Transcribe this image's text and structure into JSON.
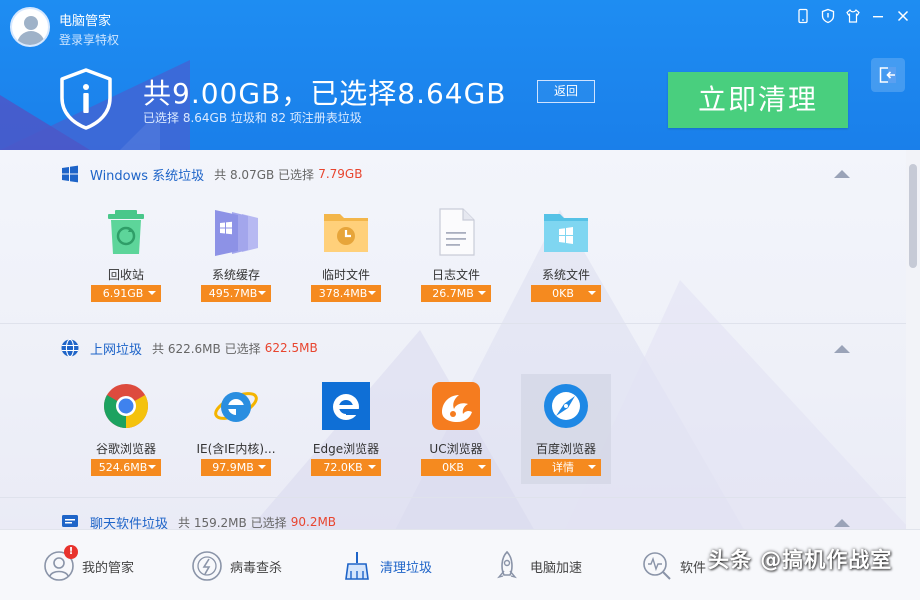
{
  "header": {
    "app_title": "电脑管家",
    "vip_link": "登录享特权",
    "window_buttons": [
      "phone-icon",
      "shield-badge-icon",
      "skin-icon",
      "minimize-icon",
      "close-icon"
    ],
    "summary_title": "共9.00GB，已选择8.64GB",
    "summary_sub": "已选择 8.64GB 垃圾和 82 项注册表垃圾",
    "back_label": "返回",
    "clean_label": "立即清理"
  },
  "sections": [
    {
      "title": "Windows 系统垃圾",
      "total": "共 8.07GB 已选择",
      "selected": "7.79GB",
      "items": [
        {
          "label": "回收站",
          "size": "6.91GB",
          "icon": "recycle-bin-icon"
        },
        {
          "label": "系统缓存",
          "size": "495.7MB",
          "icon": "system-cache-icon"
        },
        {
          "label": "临时文件",
          "size": "378.4MB",
          "icon": "temp-folder-icon"
        },
        {
          "label": "日志文件",
          "size": "26.7MB",
          "icon": "log-file-icon"
        },
        {
          "label": "系统文件",
          "size": "0KB",
          "icon": "system-folder-icon"
        }
      ]
    },
    {
      "title": "上网垃圾",
      "total": "共 622.6MB 已选择",
      "selected": "622.5MB",
      "items": [
        {
          "label": "谷歌浏览器",
          "size": "524.6MB",
          "icon": "chrome-icon"
        },
        {
          "label": "IE(含IE内核)...",
          "size": "97.9MB",
          "icon": "ie-icon"
        },
        {
          "label": "Edge浏览器",
          "size": "72.0KB",
          "icon": "edge-icon"
        },
        {
          "label": "UC浏览器",
          "size": "0KB",
          "icon": "uc-icon"
        },
        {
          "label": "百度浏览器",
          "size": "详情",
          "icon": "baidu-browser-icon"
        }
      ]
    },
    {
      "title": "聊天软件垃圾",
      "total": "共 159.2MB 已选择",
      "selected": "90.2MB",
      "items": []
    }
  ],
  "bottom_nav": [
    {
      "label": "我的管家",
      "badge": "!"
    },
    {
      "label": "病毒查杀"
    },
    {
      "label": "清理垃圾"
    },
    {
      "label": "电脑加速"
    },
    {
      "label": "软件"
    }
  ],
  "watermark": "头条 @搞机作战室",
  "colors": {
    "header_blue": "#1a7fea",
    "clean_green": "#49cf7e",
    "size_orange": "#f58a1f",
    "selected_red": "#e8452f",
    "link_blue": "#1e64c8"
  }
}
